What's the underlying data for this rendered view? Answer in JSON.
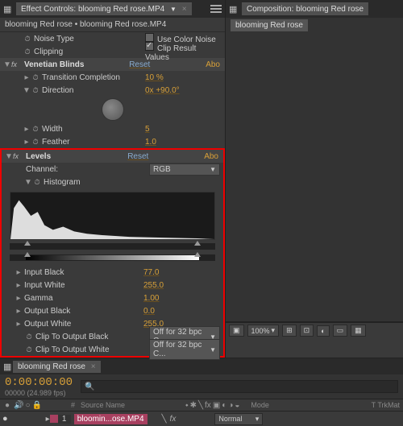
{
  "effect_controls": {
    "panel_title": "Effect Controls: blooming Red rose.MP4",
    "breadcrumb": "blooming Red rose • blooming Red rose.MP4",
    "noise_type": "Noise Type",
    "use_color_noise": "Use Color Noise",
    "clipping": "Clipping",
    "clip_result_values": "Clip Result Values",
    "venetian": {
      "name": "Venetian Blinds",
      "reset": "Reset",
      "about": "Abo",
      "transition_completion": "Transition Completion",
      "transition_completion_val": "10 %",
      "direction": "Direction",
      "direction_val": "0x +90.0°",
      "width": "Width",
      "width_val": "5",
      "feather": "Feather",
      "feather_val": "1.0"
    },
    "levels": {
      "name": "Levels",
      "reset": "Reset",
      "about": "Abo",
      "channel": "Channel:",
      "channel_val": "RGB",
      "histogram": "Histogram",
      "input_black": "Input Black",
      "input_black_val": "77.0",
      "input_white": "Input White",
      "input_white_val": "255.0",
      "gamma": "Gamma",
      "gamma_val": "1.00",
      "output_black": "Output Black",
      "output_black_val": "0.0",
      "output_white": "Output White",
      "output_white_val": "255.0",
      "clip_black": "Clip To Output Black",
      "clip_black_val": "Off for 32 bpc C...",
      "clip_white": "Clip To Output White",
      "clip_white_val": "Off for 32 bpc C..."
    }
  },
  "composition": {
    "panel_title": "Composition: blooming Red rose",
    "tab": "blooming Red rose",
    "zoom": "100%"
  },
  "timeline": {
    "tab": "blooming Red rose",
    "timecode": "0:00:00:00",
    "frame_info": "00000 (24.989 fps)",
    "search_placeholder": "",
    "col_num": "#",
    "col_source": "Source Name",
    "col_mode": "Mode",
    "col_trkmat": "T   TrkMat",
    "layer_num": "1",
    "layer_name": "bloomin...ose.MP4",
    "mode_val": "Normal"
  },
  "icons": {
    "search": "🔍",
    "eye": "👁",
    "lock": "🔒"
  }
}
